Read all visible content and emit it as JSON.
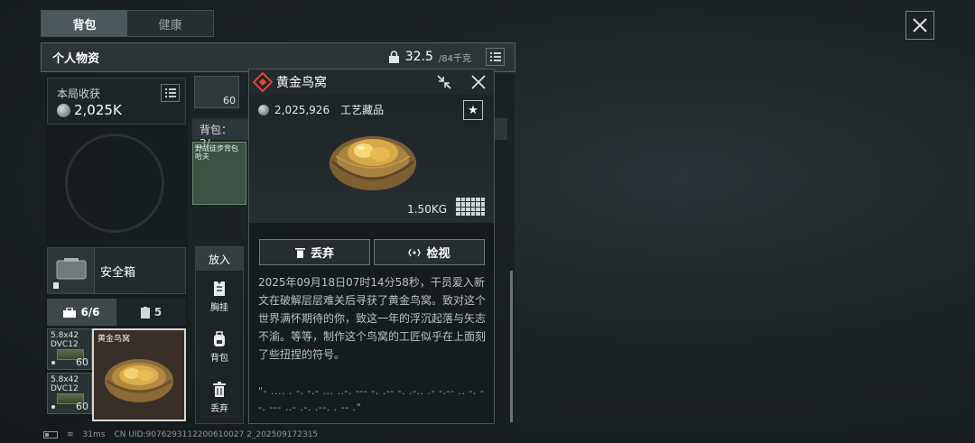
{
  "tabs": [
    {
      "label": "背包",
      "active": true
    },
    {
      "label": "健康",
      "active": false
    }
  ],
  "header": {
    "title": "个人物资",
    "weight_value": "32.5",
    "weight_max": "/84千克"
  },
  "harvest": {
    "label": "本局收获",
    "value": "2,025K"
  },
  "safebox": {
    "label": "安全箱"
  },
  "subtabs": [
    {
      "label": "6/6",
      "icon": "toolbox-icon"
    },
    {
      "label": "5",
      "icon": "clipboard-icon"
    }
  ],
  "slots": {
    "ammo": [
      {
        "label": "5.8x42 DVC12",
        "count": "60"
      },
      {
        "label": "5.8x42 DVC12",
        "count": "60"
      }
    ],
    "nest_caption": "黄金鸟窝"
  },
  "actions": {
    "put_in": "放入",
    "items": [
      {
        "label": "胸挂",
        "icon": "vest-icon"
      },
      {
        "label": "背包",
        "icon": "backpack-icon"
      },
      {
        "label": "丢弃",
        "icon": "trash-icon"
      }
    ]
  },
  "background": {
    "top_thumb_count": "60",
    "bag_label": "背包：3/",
    "bag_item": "野战徒步背包 哈夫"
  },
  "popup": {
    "title": "黄金鸟窝",
    "price": "2,025,926",
    "category": "工艺藏品",
    "weight": "1.50KG",
    "discard_label": "丢弃",
    "inspect_label": "检视",
    "description": "2025年09月18日07时14分58秒，干员爱入新文在破解层层难关后寻获了黄金鸟窝。致对这个世界满怀期待的你，致这一年的浮沉起落与矢志不渝。等等，制作这个鸟窝的工匠似乎在上面刻了些扭捏的符号。",
    "symbols": "\"- .... . -. -.- ... ..-. --- -. .-- -. .-.. .- -.-- .. -. --. --- ..- .-. .--. . -- .\""
  },
  "status": {
    "ping": "31ms",
    "uid": "CN UID:9076293112200610027 2_202509172315"
  },
  "colors": {
    "accent_red": "#d9473f",
    "panel_bg": "#181e20",
    "active_tab": "#4d585c"
  }
}
